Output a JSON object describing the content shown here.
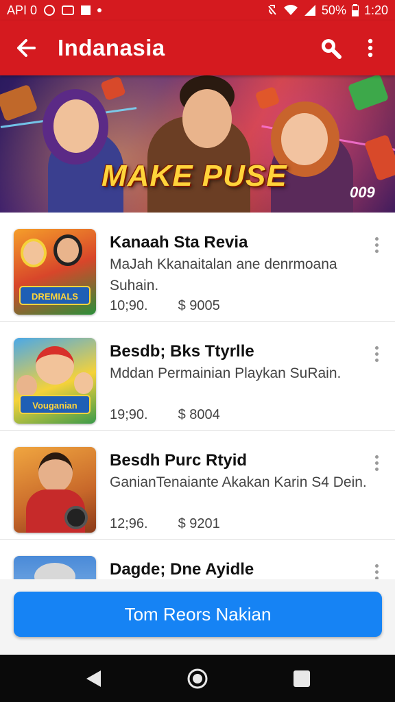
{
  "status_bar": {
    "left_text": "API 0",
    "battery": "50%",
    "time": "1:20"
  },
  "app_bar": {
    "title": "Indanasia",
    "back_icon": "arrow-left-icon",
    "search_icon": "search-icon",
    "more_icon": "more-vertical-icon",
    "background_color": "#d51a1f"
  },
  "banner": {
    "title": "MAKE PUSE",
    "tag": "009"
  },
  "items": [
    {
      "title": "Kanaah Sta Revia",
      "desc": "MaJah Kkanaitalan ane denrmoana Suhain.",
      "rating": "10;90.",
      "price": "$ 9005",
      "thumb_label": "DREMIALS"
    },
    {
      "title": "Besdb; Bks Ttyrlle",
      "desc": "Mddan Permainian Playkan SuRain.",
      "rating": "19;90.",
      "price": "$ 8004",
      "thumb_label": "Vouganian"
    },
    {
      "title": "Besdh Purc Rtyid",
      "desc": "GanianTenaiante Akakan Karin S4 Dein.",
      "rating": "12;96.",
      "price": "$ 9201",
      "thumb_label": ""
    },
    {
      "title": "Dagde; Dne Ayidle",
      "desc": "",
      "rating": "",
      "price": "",
      "thumb_label": ""
    }
  ],
  "cta": {
    "label": "Tom Reors Nakian",
    "color": "#1683f4"
  },
  "nav_bar": {
    "back_icon": "nav-back-icon",
    "home_icon": "nav-home-icon",
    "recents_icon": "nav-recents-icon"
  }
}
